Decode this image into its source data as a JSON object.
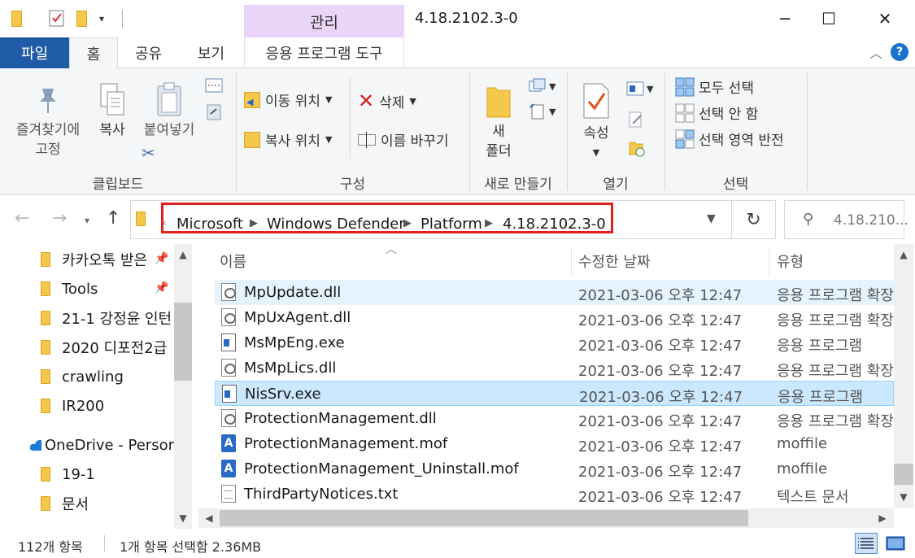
{
  "window": {
    "title": "4.18.2102.3-0",
    "manage_tab": "관리",
    "controls": {
      "minimize": "─",
      "maximize": "☐",
      "close": "✕"
    }
  },
  "ribbon_tabs": {
    "file": "파일",
    "home": "홈",
    "share": "공유",
    "view": "보기",
    "app_tools": "응용 프로그램 도구",
    "collapse": "︿",
    "help": "?"
  },
  "ribbon": {
    "clipboard": {
      "pin_line1": "즐겨찾기에",
      "pin_line2": "고정",
      "copy": "복사",
      "paste": "붙여넣기",
      "label": "클립보드"
    },
    "organize": {
      "move_to": "이동 위치",
      "copy_to": "복사 위치",
      "delete": "삭제",
      "rename": "이름 바꾸기",
      "label": "구성"
    },
    "new": {
      "new_folder_line1": "새",
      "new_folder_line2": "폴더",
      "label": "새로 만들기"
    },
    "open": {
      "properties": "속성",
      "label": "열기"
    },
    "select": {
      "select_all": "모두 선택",
      "select_none": "선택 안 함",
      "invert": "선택 영역 반전",
      "label": "선택"
    }
  },
  "address": {
    "crumbs": [
      "Microsoft",
      "Windows Defender",
      "Platform",
      "4.18.2102.3-0"
    ],
    "search_placeholder": "4.18.210..."
  },
  "nav": {
    "items": [
      {
        "label": "카카오톡 받은",
        "pinned": true
      },
      {
        "label": "Tools",
        "pinned": true
      },
      {
        "label": "21-1 강정윤 인턴",
        "pinned": false
      },
      {
        "label": "2020 디포전2급",
        "pinned": false
      },
      {
        "label": "crawling",
        "pinned": false
      },
      {
        "label": "IR200",
        "pinned": false
      }
    ],
    "onedrive": "OneDrive - Persor",
    "onedrive_items": [
      "19-1",
      "문서"
    ]
  },
  "columns": {
    "name": "이름",
    "date": "수정한 날짜",
    "type": "유형"
  },
  "files": [
    {
      "name": "MpUpdate.dll",
      "date": "2021-03-06 오후 12:47",
      "type": "응용 프로그램 확장",
      "icon": "dll",
      "state": "hover"
    },
    {
      "name": "MpUxAgent.dll",
      "date": "2021-03-06 오후 12:47",
      "type": "응용 프로그램 확장",
      "icon": "dll",
      "state": ""
    },
    {
      "name": "MsMpEng.exe",
      "date": "2021-03-06 오후 12:47",
      "type": "응용 프로그램",
      "icon": "exe",
      "state": ""
    },
    {
      "name": "MsMpLics.dll",
      "date": "2021-03-06 오후 12:47",
      "type": "응용 프로그램 확장",
      "icon": "dll",
      "state": ""
    },
    {
      "name": "NisSrv.exe",
      "date": "2021-03-06 오후 12:47",
      "type": "응용 프로그램",
      "icon": "exe",
      "state": "selected"
    },
    {
      "name": "ProtectionManagement.dll",
      "date": "2021-03-06 오후 12:47",
      "type": "응용 프로그램 확장",
      "icon": "dll",
      "state": ""
    },
    {
      "name": "ProtectionManagement.mof",
      "date": "2021-03-06 오후 12:47",
      "type": "moffile",
      "icon": "mof",
      "state": ""
    },
    {
      "name": "ProtectionManagement_Uninstall.mof",
      "date": "2021-03-06 오후 12:47",
      "type": "moffile",
      "icon": "mof",
      "state": ""
    },
    {
      "name": "ThirdPartyNotices.txt",
      "date": "2021-03-06 오후 12:47",
      "type": "텍스트 문서",
      "icon": "txt",
      "state": ""
    }
  ],
  "status": {
    "count": "112개 항목",
    "selection": "1개 항목 선택함 2.36MB"
  }
}
